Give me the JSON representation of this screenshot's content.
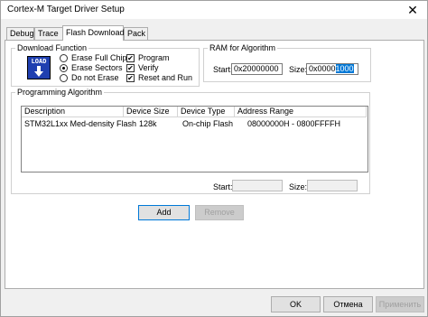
{
  "window": {
    "title": "Cortex-M Target Driver Setup"
  },
  "tabs": [
    {
      "label": "Debug"
    },
    {
      "label": "Trace"
    },
    {
      "label": "Flash Download",
      "active": true
    },
    {
      "label": "Pack"
    }
  ],
  "download_function": {
    "legend": "Download Function",
    "icon_label": "LOAD",
    "radios": [
      {
        "label": "Erase Full Chip",
        "selected": false
      },
      {
        "label": "Erase Sectors",
        "selected": true
      },
      {
        "label": "Do not Erase",
        "selected": false
      }
    ],
    "checks": [
      {
        "label": "Program",
        "checked": true
      },
      {
        "label": "Verify",
        "checked": true
      },
      {
        "label": "Reset and Run",
        "checked": true
      }
    ],
    "check_mark": "✔"
  },
  "ram": {
    "legend": "RAM for Algorithm",
    "start_label": "Start:",
    "start_value": "0x20000000",
    "size_label": "Size:",
    "size_prefix": "0x0000",
    "size_selected": "1000"
  },
  "algorithm": {
    "legend": "Programming Algorithm",
    "columns": [
      "Description",
      "Device Size",
      "Device Type",
      "Address Range"
    ],
    "rows": [
      {
        "description": "STM32L1xx Med-density Flash",
        "size": "128k",
        "type": "On-chip Flash",
        "range": "08000000H - 0800FFFFH"
      }
    ],
    "start_label": "Start:",
    "size_label": "Size:",
    "add_label": "Add",
    "remove_label": "Remove"
  },
  "footer": {
    "ok_label": "OK",
    "cancel_label": "Отмена",
    "apply_label": "Применить"
  }
}
